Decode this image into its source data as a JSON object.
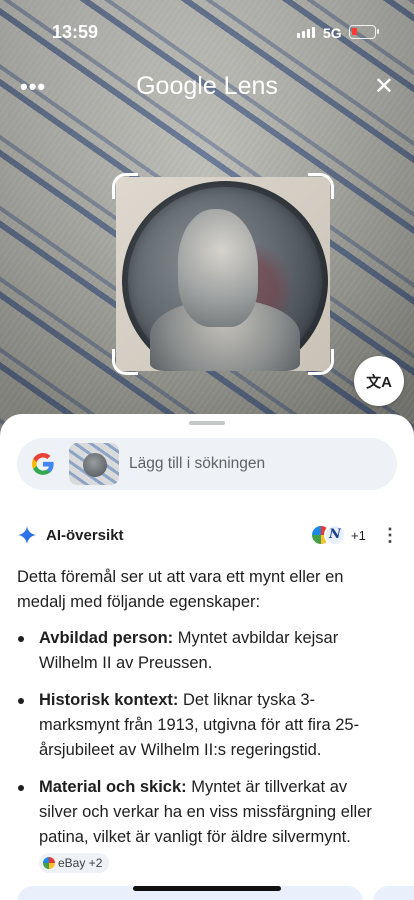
{
  "status_bar": {
    "time": "13:59",
    "network": "5G"
  },
  "header": {
    "title": "Google Lens",
    "more_icon": "more-horizontal-icon",
    "close_icon": "close-icon"
  },
  "translate_button": {
    "icon": "translate-icon",
    "glyph": "文A"
  },
  "search_bar": {
    "placeholder": "Lägg till i sökningen"
  },
  "ai_overview": {
    "label": "AI-översikt",
    "source_count": "+1",
    "intro": "Detta föremål ser ut att vara ett mynt eller en medalj med följande egenskaper:",
    "bullets": [
      {
        "title": "Avbildad person:",
        "text": " Myntet avbildar kejsar Wilhelm II av Preussen."
      },
      {
        "title": "Historisk kontext:",
        "text": " Det liknar tyska 3-marksmynt från 1913, utgivna för att fira 25-årsjubileet av Wilhelm II:s regeringstid."
      },
      {
        "title": "Material och skick:",
        "text": " Myntet är tillverkat av silver och verkar ha en viss missfärgning eller patina, vilket är vanligt för äldre silvermynt.",
        "chip": "eBay +2"
      }
    ]
  },
  "colors": {
    "accent": "#1a73e8",
    "sheet_bg": "#ffffff",
    "search_bg": "#eef1f5"
  }
}
